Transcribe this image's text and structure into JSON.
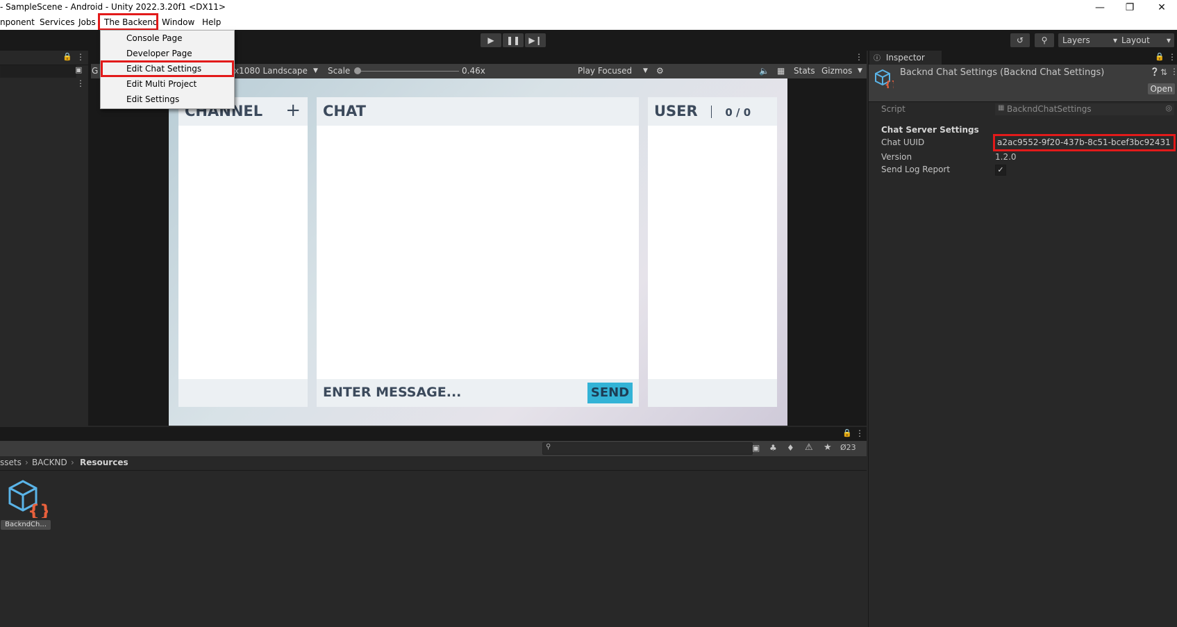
{
  "window": {
    "title": "- SampleScene - Android - Unity 2022.3.20f1 <DX11>",
    "controls": [
      "minimize-icon",
      "restore-icon",
      "close-icon"
    ]
  },
  "menubar": {
    "items": [
      "nponent",
      "Services",
      "Jobs",
      "The Backend",
      "Window",
      "Help"
    ],
    "highlighted": "The Backend"
  },
  "dropdown": {
    "items": [
      "Console Page",
      "Developer Page",
      "Edit Chat Settings",
      "Edit Multi Project",
      "Edit Settings"
    ],
    "highlighted": "Edit Chat Settings"
  },
  "toolbar": {
    "layers_label": "Layers",
    "layout_label": "Layout"
  },
  "game_toolbar": {
    "tab_prefix": "G",
    "resolution": "x1080 Landscape",
    "scale_label": "Scale",
    "scale_value": "0.46x",
    "play_mode": "Play Focused",
    "stats": "Stats",
    "gizmos": "Gizmos"
  },
  "game_ui": {
    "channel_title": "CHANNEL",
    "chat_title": "CHAT",
    "user_title": "USER",
    "user_count": "0 / 0",
    "message_placeholder": "ENTER MESSAGE...",
    "send_label": "SEND",
    "accent_color": "#33b3d6"
  },
  "inspector": {
    "tab_label": "Inspector",
    "object_title": "Backnd Chat Settings (Backnd Chat Settings)",
    "open_button": "Open",
    "script_label": "Script",
    "script_value": "BackndChatSettings",
    "section_header": "Chat Server Settings",
    "fields": [
      {
        "label": "Chat UUID",
        "value": "a2ac9552-9f20-437b-8c51-bcef3bc92431"
      },
      {
        "label": "Version",
        "value": "1.2.0"
      },
      {
        "label": "Send Log Report",
        "value": "✓"
      }
    ]
  },
  "project": {
    "breadcrumb": [
      "ssets",
      "BACKND",
      "Resources"
    ],
    "asset_name": "BackndCh...",
    "hidden_count": "23"
  },
  "highlight_color": "#e21a1a"
}
